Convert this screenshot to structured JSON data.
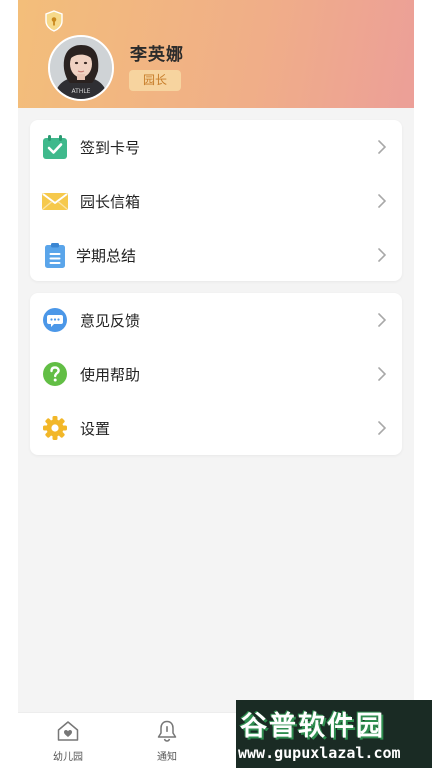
{
  "profile": {
    "name": "李英娜",
    "role": "园长"
  },
  "menu_group_1": [
    {
      "label": "签到卡号",
      "icon": "calendar-check-icon"
    },
    {
      "label": "园长信箱",
      "icon": "envelope-icon"
    },
    {
      "label": "学期总结",
      "icon": "clipboard-icon"
    }
  ],
  "menu_group_2": [
    {
      "label": "意见反馈",
      "icon": "chat-bubble-icon"
    },
    {
      "label": "使用帮助",
      "icon": "question-icon"
    },
    {
      "label": "设置",
      "icon": "gear-icon"
    }
  ],
  "tabbar": {
    "home_label": "幼儿园",
    "notify_label": "通知"
  },
  "watermark": {
    "title": "谷普软件园",
    "url": "www.gupuxlazal.com"
  },
  "colors": {
    "header_start": "#f3be7a",
    "header_end": "#ec9f98",
    "badge_bg": "#f7d49f",
    "badge_text": "#c77d2a"
  }
}
